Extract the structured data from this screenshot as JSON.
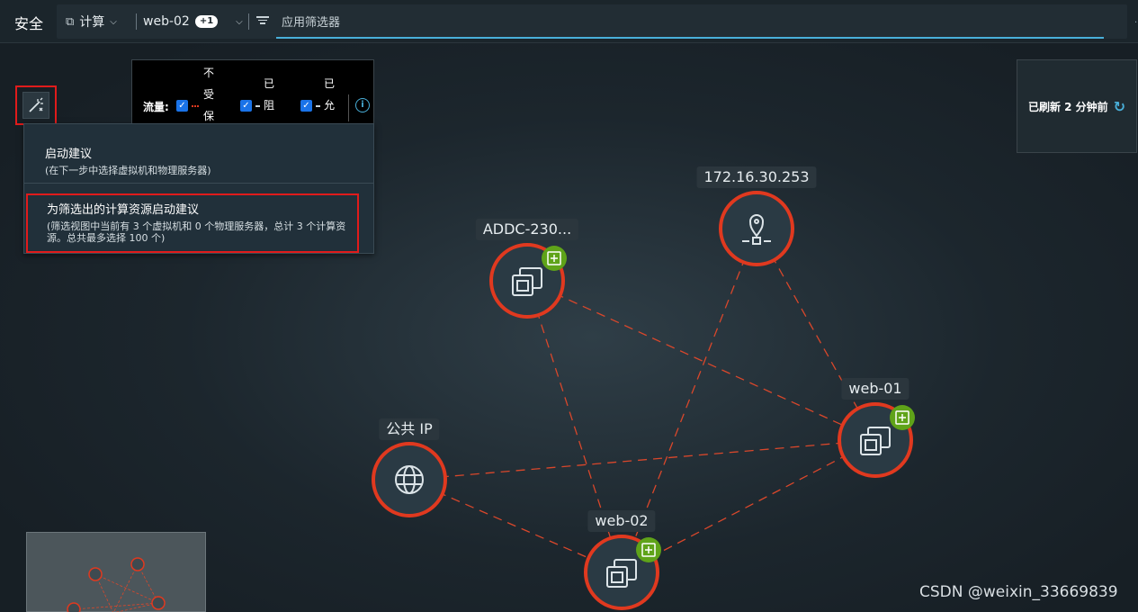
{
  "header": {
    "section_title": "安全",
    "compute_filter": "计算",
    "selected_vm": "web-02",
    "extra_count": "+1",
    "app_filter_placeholder": "应用筛选器"
  },
  "legend": {
    "flow_label": "流量:",
    "unprotected": [
      "不",
      "受",
      "保"
    ],
    "blocked": [
      "已",
      "阻"
    ],
    "allowed": [
      "已",
      "允"
    ]
  },
  "menu": {
    "item1": {
      "title": "启动建议",
      "desc": "(在下一步中选择虚拟机和物理服务器)"
    },
    "item2": {
      "title": "为筛选出的计算资源启动建议",
      "desc": "(筛选视图中当前有 3 个虚拟机和 0 个物理服务器，总计 3 个计算资源。总共最多选择 100 个)"
    }
  },
  "refresh": {
    "label": "已刷新 2 分钟前"
  },
  "nodes": {
    "addc": {
      "label": "ADDC-230...",
      "icon": "vm-icon"
    },
    "ip172": {
      "label": "172.16.30.253",
      "icon": "location-pin-icon"
    },
    "web01": {
      "label": "web-01",
      "icon": "vm-icon"
    },
    "public_ip": {
      "label": "公共 IP",
      "icon": "globe-icon"
    },
    "web02": {
      "label": "web-02",
      "icon": "vm-icon"
    }
  },
  "colors": {
    "node_ring": "#e0391f",
    "edge": "#d9472b",
    "accent": "#49afd9",
    "add_badge": "#5fa319"
  },
  "watermark": "CSDN @weixin_33669839"
}
